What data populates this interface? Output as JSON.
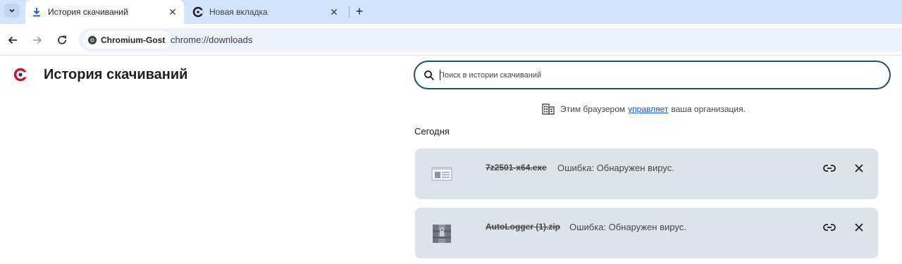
{
  "tabs": [
    {
      "title": "История скачиваний",
      "active": true,
      "icon": "download-icon"
    },
    {
      "title": "Новая вкладка",
      "active": false,
      "icon": "chromium-gost-icon"
    }
  ],
  "new_tab_symbol": "+",
  "close_symbol": "✕",
  "toolbar": {
    "site_chip": "Chromium-Gost",
    "url": "chrome://downloads"
  },
  "page": {
    "title": "История скачиваний",
    "search_placeholder": "Поиск в истории скачиваний",
    "managed_prefix": "Этим браузером",
    "managed_link": "управляет",
    "managed_suffix": "ваша организация.",
    "section_date": "Сегодня"
  },
  "downloads": [
    {
      "filename": "7z2501-x64.exe",
      "status": "Ошибка: Обнаружен вирус.",
      "icon": "exe-file-icon"
    },
    {
      "filename": "AutoLogger (1).zip",
      "status": "Ошибка: Обнаружен вирус.",
      "icon": "archive-file-icon"
    }
  ],
  "colors": {
    "tabstrip": "#d3e3fd",
    "search_border": "#1e4e7a",
    "card_bg": "#dde3ea",
    "link": "#0b57d0",
    "brand_accent": "#c8102e"
  }
}
